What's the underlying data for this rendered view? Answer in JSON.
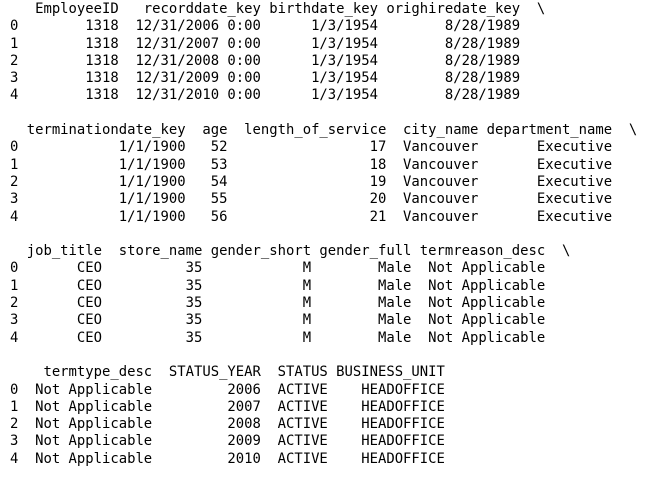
{
  "dataframe_output": [
    "   EmployeeID   recorddate_key birthdate_key orighiredate_key  \\",
    "0        1318  12/31/2006 0:00      1/3/1954        8/28/1989   ",
    "1        1318  12/31/2007 0:00      1/3/1954        8/28/1989   ",
    "2        1318  12/31/2008 0:00      1/3/1954        8/28/1989   ",
    "3        1318  12/31/2009 0:00      1/3/1954        8/28/1989   ",
    "4        1318  12/31/2010 0:00      1/3/1954        8/28/1989   ",
    "",
    "  terminationdate_key  age  length_of_service  city_name department_name  \\",
    "0            1/1/1900   52                 17  Vancouver       Executive   ",
    "1            1/1/1900   53                 18  Vancouver       Executive   ",
    "2            1/1/1900   54                 19  Vancouver       Executive   ",
    "3            1/1/1900   55                 20  Vancouver       Executive   ",
    "4            1/1/1900   56                 21  Vancouver       Executive   ",
    "",
    "  job_title  store_name gender_short gender_full termreason_desc  \\",
    "0       CEO          35            M        Male  Not Applicable   ",
    "1       CEO          35            M        Male  Not Applicable   ",
    "2       CEO          35            M        Male  Not Applicable   ",
    "3       CEO          35            M        Male  Not Applicable   ",
    "4       CEO          35            M        Male  Not Applicable   ",
    "",
    "    termtype_desc  STATUS_YEAR  STATUS BUSINESS_UNIT  ",
    "0  Not Applicable         2006  ACTIVE    HEADOFFICE  ",
    "1  Not Applicable         2007  ACTIVE    HEADOFFICE  ",
    "2  Not Applicable         2008  ACTIVE    HEADOFFICE  ",
    "3  Not Applicable         2009  ACTIVE    HEADOFFICE  ",
    "4  Not Applicable         2010  ACTIVE    HEADOFFICE  "
  ]
}
